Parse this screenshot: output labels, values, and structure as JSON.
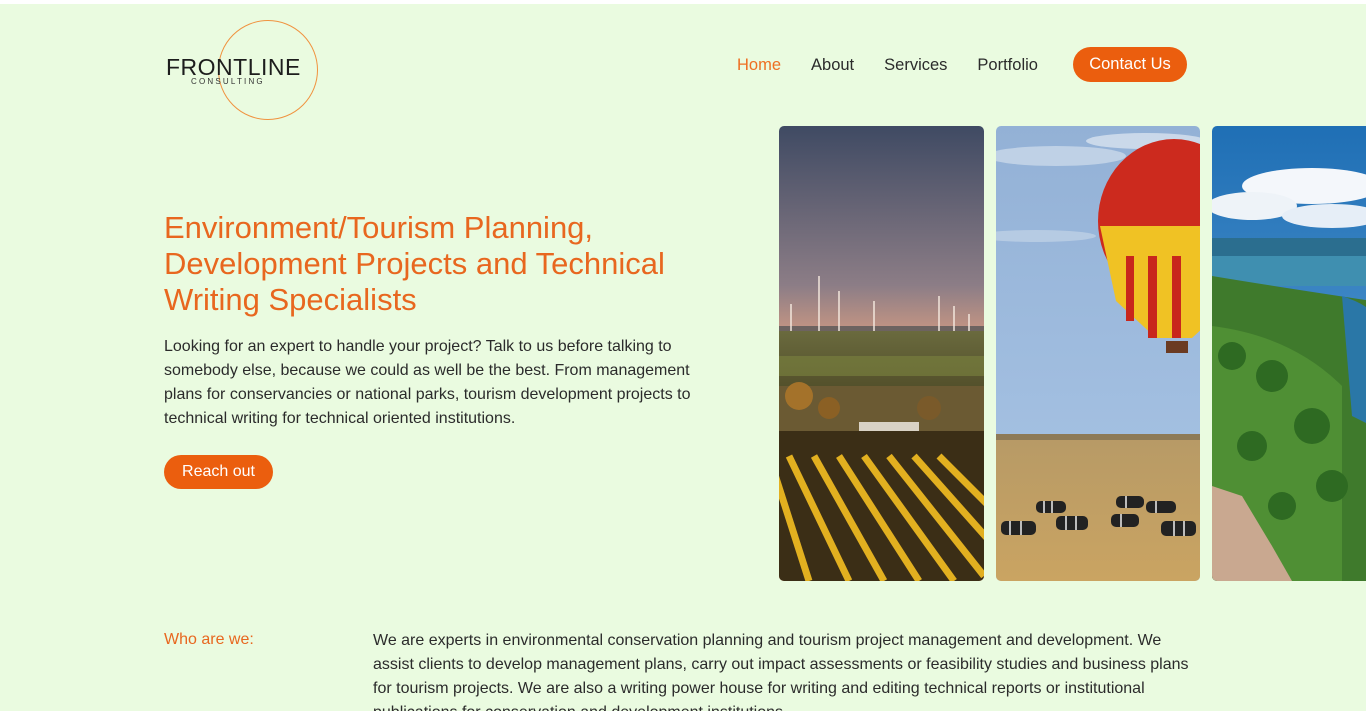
{
  "brand": {
    "name": "FRONTLINE",
    "tagline": "CONSULTING"
  },
  "nav": {
    "items": [
      {
        "label": "Home",
        "active": true
      },
      {
        "label": "About",
        "active": false
      },
      {
        "label": "Services",
        "active": false
      },
      {
        "label": "Portfolio",
        "active": false
      }
    ],
    "contact_label": "Contact Us"
  },
  "hero": {
    "title": "Environment/Tourism Planning, Development Projects and Technical Writing Specialists",
    "body": "Looking for an expert to handle your project? Talk to us before talking to somebody else, because we could as well be the best. From management plans for conservancies or national parks, tourism development projects to technical writing for technical oriented institutions.",
    "cta_label": "Reach out"
  },
  "gallery": {
    "images": [
      "wind-farm-vineyard-photo",
      "hot-air-balloon-zebras-photo",
      "coastal-forest-lake-photo"
    ]
  },
  "about": {
    "label": "Who are we:",
    "text": "We are experts in environmental conservation planning and tourism project management and development. We assist clients to develop management plans, carry out impact assessments or feasibility studies and business plans for tourism projects. We are also a writing power house for writing and editing technical reports or institutional publications for conservation and development institutions."
  },
  "colors": {
    "background": "#eafbe0",
    "accent": "#eb5e0e",
    "accent_text": "#e8671f"
  }
}
